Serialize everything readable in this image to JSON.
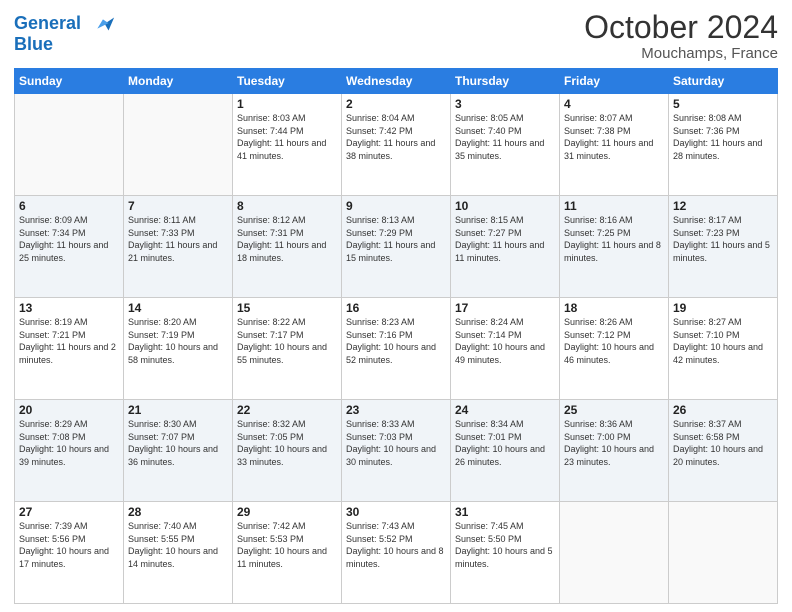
{
  "header": {
    "logo_line1": "General",
    "logo_line2": "Blue",
    "month": "October 2024",
    "location": "Mouchamps, France"
  },
  "days_of_week": [
    "Sunday",
    "Monday",
    "Tuesday",
    "Wednesday",
    "Thursday",
    "Friday",
    "Saturday"
  ],
  "weeks": [
    [
      {
        "day": "",
        "text": ""
      },
      {
        "day": "",
        "text": ""
      },
      {
        "day": "1",
        "text": "Sunrise: 8:03 AM\nSunset: 7:44 PM\nDaylight: 11 hours and 41 minutes."
      },
      {
        "day": "2",
        "text": "Sunrise: 8:04 AM\nSunset: 7:42 PM\nDaylight: 11 hours and 38 minutes."
      },
      {
        "day": "3",
        "text": "Sunrise: 8:05 AM\nSunset: 7:40 PM\nDaylight: 11 hours and 35 minutes."
      },
      {
        "day": "4",
        "text": "Sunrise: 8:07 AM\nSunset: 7:38 PM\nDaylight: 11 hours and 31 minutes."
      },
      {
        "day": "5",
        "text": "Sunrise: 8:08 AM\nSunset: 7:36 PM\nDaylight: 11 hours and 28 minutes."
      }
    ],
    [
      {
        "day": "6",
        "text": "Sunrise: 8:09 AM\nSunset: 7:34 PM\nDaylight: 11 hours and 25 minutes."
      },
      {
        "day": "7",
        "text": "Sunrise: 8:11 AM\nSunset: 7:33 PM\nDaylight: 11 hours and 21 minutes."
      },
      {
        "day": "8",
        "text": "Sunrise: 8:12 AM\nSunset: 7:31 PM\nDaylight: 11 hours and 18 minutes."
      },
      {
        "day": "9",
        "text": "Sunrise: 8:13 AM\nSunset: 7:29 PM\nDaylight: 11 hours and 15 minutes."
      },
      {
        "day": "10",
        "text": "Sunrise: 8:15 AM\nSunset: 7:27 PM\nDaylight: 11 hours and 11 minutes."
      },
      {
        "day": "11",
        "text": "Sunrise: 8:16 AM\nSunset: 7:25 PM\nDaylight: 11 hours and 8 minutes."
      },
      {
        "day": "12",
        "text": "Sunrise: 8:17 AM\nSunset: 7:23 PM\nDaylight: 11 hours and 5 minutes."
      }
    ],
    [
      {
        "day": "13",
        "text": "Sunrise: 8:19 AM\nSunset: 7:21 PM\nDaylight: 11 hours and 2 minutes."
      },
      {
        "day": "14",
        "text": "Sunrise: 8:20 AM\nSunset: 7:19 PM\nDaylight: 10 hours and 58 minutes."
      },
      {
        "day": "15",
        "text": "Sunrise: 8:22 AM\nSunset: 7:17 PM\nDaylight: 10 hours and 55 minutes."
      },
      {
        "day": "16",
        "text": "Sunrise: 8:23 AM\nSunset: 7:16 PM\nDaylight: 10 hours and 52 minutes."
      },
      {
        "day": "17",
        "text": "Sunrise: 8:24 AM\nSunset: 7:14 PM\nDaylight: 10 hours and 49 minutes."
      },
      {
        "day": "18",
        "text": "Sunrise: 8:26 AM\nSunset: 7:12 PM\nDaylight: 10 hours and 46 minutes."
      },
      {
        "day": "19",
        "text": "Sunrise: 8:27 AM\nSunset: 7:10 PM\nDaylight: 10 hours and 42 minutes."
      }
    ],
    [
      {
        "day": "20",
        "text": "Sunrise: 8:29 AM\nSunset: 7:08 PM\nDaylight: 10 hours and 39 minutes."
      },
      {
        "day": "21",
        "text": "Sunrise: 8:30 AM\nSunset: 7:07 PM\nDaylight: 10 hours and 36 minutes."
      },
      {
        "day": "22",
        "text": "Sunrise: 8:32 AM\nSunset: 7:05 PM\nDaylight: 10 hours and 33 minutes."
      },
      {
        "day": "23",
        "text": "Sunrise: 8:33 AM\nSunset: 7:03 PM\nDaylight: 10 hours and 30 minutes."
      },
      {
        "day": "24",
        "text": "Sunrise: 8:34 AM\nSunset: 7:01 PM\nDaylight: 10 hours and 26 minutes."
      },
      {
        "day": "25",
        "text": "Sunrise: 8:36 AM\nSunset: 7:00 PM\nDaylight: 10 hours and 23 minutes."
      },
      {
        "day": "26",
        "text": "Sunrise: 8:37 AM\nSunset: 6:58 PM\nDaylight: 10 hours and 20 minutes."
      }
    ],
    [
      {
        "day": "27",
        "text": "Sunrise: 7:39 AM\nSunset: 5:56 PM\nDaylight: 10 hours and 17 minutes."
      },
      {
        "day": "28",
        "text": "Sunrise: 7:40 AM\nSunset: 5:55 PM\nDaylight: 10 hours and 14 minutes."
      },
      {
        "day": "29",
        "text": "Sunrise: 7:42 AM\nSunset: 5:53 PM\nDaylight: 10 hours and 11 minutes."
      },
      {
        "day": "30",
        "text": "Sunrise: 7:43 AM\nSunset: 5:52 PM\nDaylight: 10 hours and 8 minutes."
      },
      {
        "day": "31",
        "text": "Sunrise: 7:45 AM\nSunset: 5:50 PM\nDaylight: 10 hours and 5 minutes."
      },
      {
        "day": "",
        "text": ""
      },
      {
        "day": "",
        "text": ""
      }
    ]
  ]
}
